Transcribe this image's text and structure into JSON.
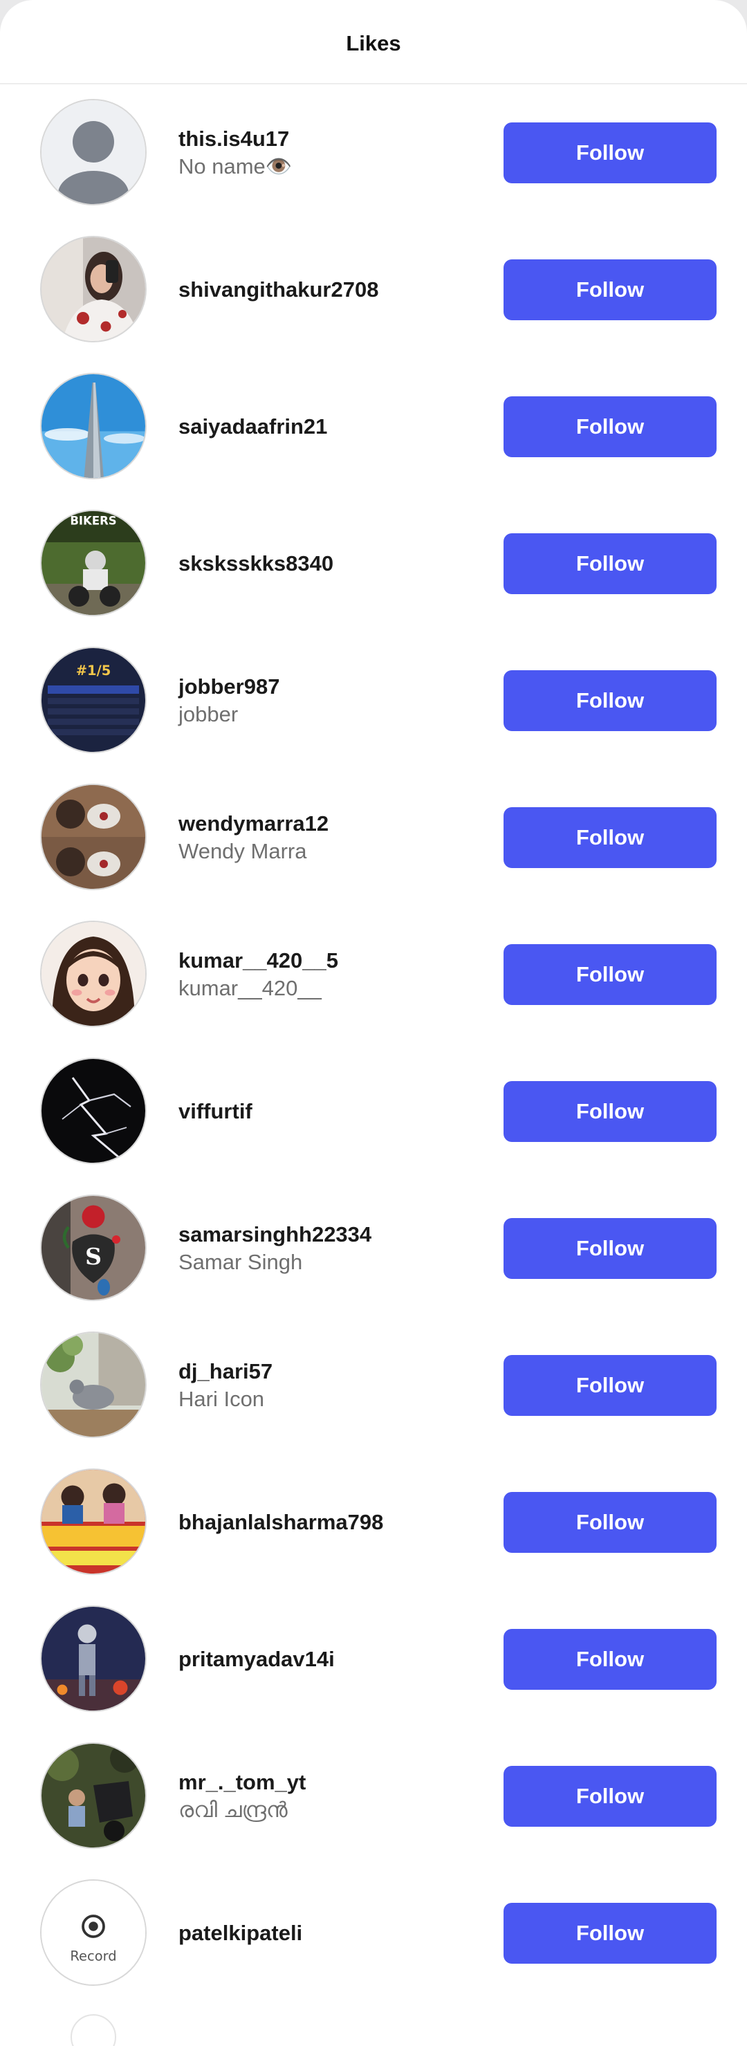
{
  "header": {
    "title": "Likes"
  },
  "follow_label": "Follow",
  "users": [
    {
      "username": "this.is4u17",
      "fullname": "No name👁️",
      "avatar": "default-avatar"
    },
    {
      "username": "shivangithakur2708",
      "fullname": "",
      "avatar": "selfie-photo"
    },
    {
      "username": "saiyadaafrin21",
      "fullname": "",
      "avatar": "tower-sky-photo"
    },
    {
      "username": "sksksskks8340",
      "fullname": "",
      "avatar": "bikers-photo"
    },
    {
      "username": "jobber987",
      "fullname": "jobber",
      "avatar": "game-scoreboard"
    },
    {
      "username": "wendymarra12",
      "fullname": "Wendy Marra",
      "avatar": "collage-photo"
    },
    {
      "username": "kumar__420__5",
      "fullname": "kumar__420__",
      "avatar": "cartoon-girl"
    },
    {
      "username": "viffurtif",
      "fullname": "",
      "avatar": "lightning-photo"
    },
    {
      "username": "samarsinghh22334",
      "fullname": "Samar Singh",
      "avatar": "rose-letter-s"
    },
    {
      "username": "dj_hari57",
      "fullname": "Hari Icon",
      "avatar": "pigeon-photo"
    },
    {
      "username": "bhajanlalsharma798",
      "fullname": "",
      "avatar": "movie-poster"
    },
    {
      "username": "pritamyadav14i",
      "fullname": "",
      "avatar": "game-character"
    },
    {
      "username": "mr_._tom_yt",
      "fullname": "രവി ചന്ദ്രൻ",
      "avatar": "motorbike-photo"
    },
    {
      "username": "patelkipateli",
      "fullname": "",
      "avatar": "record-avatar",
      "avatar_text": "Record"
    }
  ],
  "colors": {
    "follow_button": "#4a57f2",
    "follow_text": "#ffffff"
  }
}
